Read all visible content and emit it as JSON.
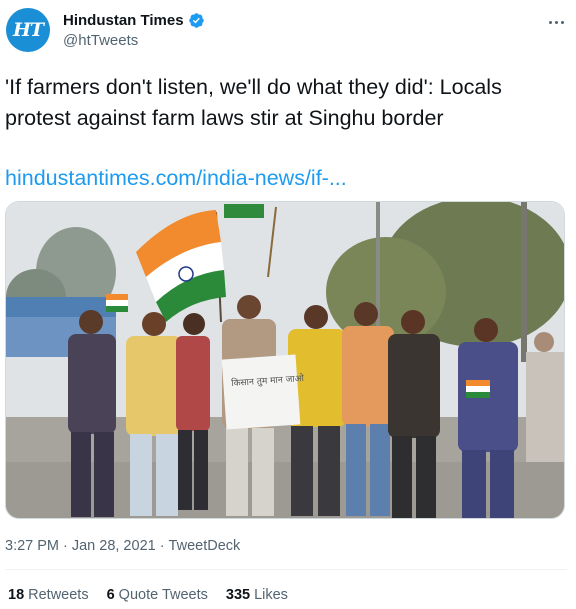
{
  "account": {
    "display_name": "Hindustan Times",
    "handle": "@htTweets",
    "avatar_text": "HT",
    "verified": true
  },
  "tweet": {
    "text": "'If farmers don't listen, we'll do what they did': Locals protest against farm laws stir at Singhu border",
    "link_text": "hindustantimes.com/india-news/if-..."
  },
  "photo": {
    "placard_text": "किसान तुम मान जाओ"
  },
  "meta": {
    "time": "3:27 PM",
    "separator1": "·",
    "date": "Jan 28, 2021",
    "separator2": "·",
    "source": "TweetDeck"
  },
  "stats": [
    {
      "count": "18",
      "label": "Retweets"
    },
    {
      "count": "6",
      "label": "Quote Tweets"
    },
    {
      "count": "335",
      "label": "Likes"
    }
  ],
  "colors": {
    "accent": "#1d9bf0",
    "avatar_bg": "#1a8fd6",
    "muted": "#536471"
  },
  "icons": [
    "verified-badge-icon",
    "more-options-icon"
  ]
}
